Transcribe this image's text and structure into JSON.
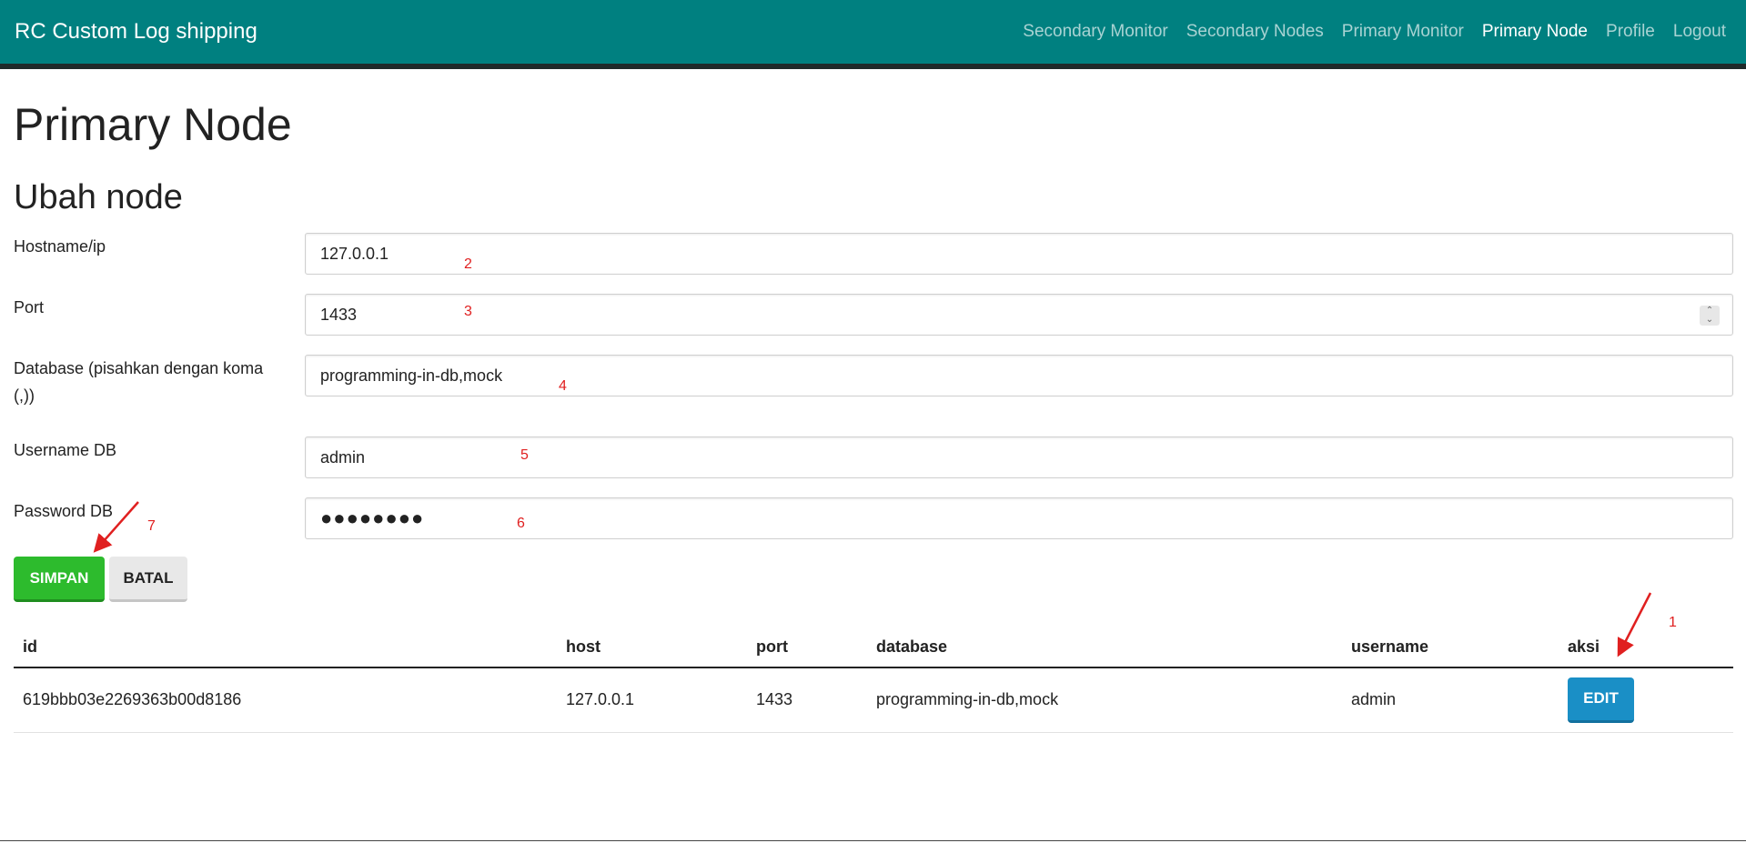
{
  "navbar": {
    "brand": "RC Custom Log shipping",
    "links": [
      {
        "label": "Secondary Monitor",
        "active": false
      },
      {
        "label": "Secondary Nodes",
        "active": false
      },
      {
        "label": "Primary Monitor",
        "active": false
      },
      {
        "label": "Primary Node",
        "active": true
      },
      {
        "label": "Profile",
        "active": false
      },
      {
        "label": "Logout",
        "active": false
      }
    ]
  },
  "page": {
    "title": "Primary Node",
    "section_title": "Ubah node"
  },
  "form": {
    "hostname": {
      "label": "Hostname/ip",
      "value": "127.0.0.1"
    },
    "port": {
      "label": "Port",
      "value": "1433"
    },
    "database": {
      "label": "Database (pisahkan dengan koma (,))",
      "value": "programming-in-db,mock"
    },
    "username": {
      "label": "Username DB",
      "value": "admin"
    },
    "password": {
      "label": "Password DB",
      "value": "●●●●●●●●"
    },
    "save_label": "SIMPAN",
    "cancel_label": "BATAL"
  },
  "table": {
    "headers": [
      "id",
      "host",
      "port",
      "database",
      "username",
      "aksi"
    ],
    "rows": [
      {
        "id": "619bbb03e2269363b00d8186",
        "host": "127.0.0.1",
        "port": "1433",
        "database": "programming-in-db,mock",
        "username": "admin",
        "action_label": "EDIT"
      }
    ]
  },
  "annotations": [
    "1",
    "2",
    "3",
    "4",
    "5",
    "6",
    "7"
  ],
  "colors": {
    "navbar": "#008080",
    "save_button": "#2dbb2d",
    "edit_button": "#1a8fc6",
    "annotation": "#e02020"
  }
}
